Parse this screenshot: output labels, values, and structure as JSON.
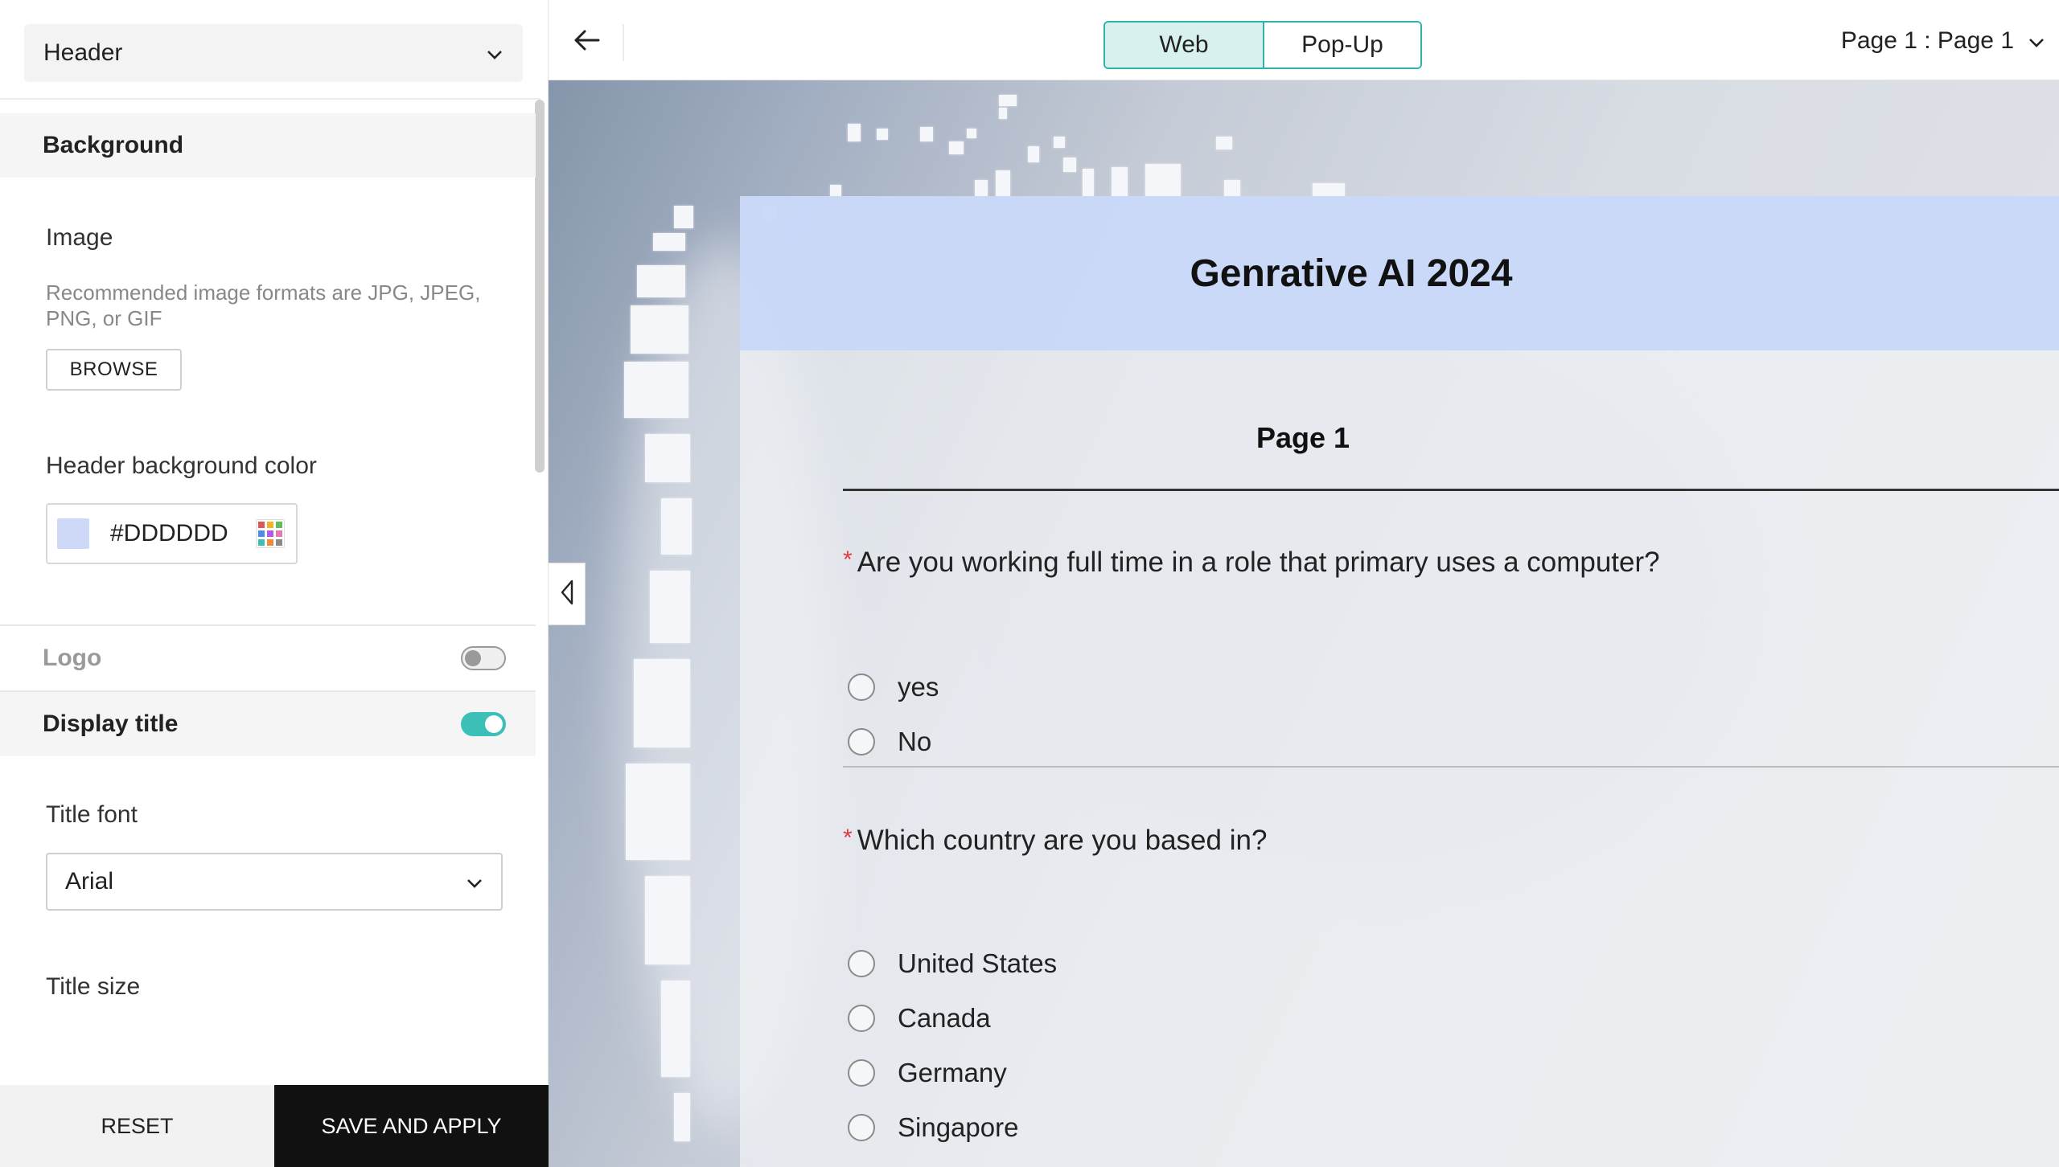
{
  "left_panel": {
    "section_select": "Header",
    "background_group": "Background",
    "image_label": "Image",
    "image_hint": "Recommended image formats are JPG, JPEG, PNG, or GIF",
    "browse_label": "BROWSE",
    "header_bg_color_label": "Header background color",
    "header_bg_color_value": "#DDDDDD",
    "header_bg_swatch_color": "#cdd9f6",
    "logo_label": "Logo",
    "logo_enabled": false,
    "display_title_label": "Display title",
    "display_title_enabled": true,
    "title_font_label": "Title font",
    "title_font_value": "Arial",
    "title_size_label": "Title size",
    "reset_label": "RESET",
    "save_label": "SAVE AND APPLY"
  },
  "topbar": {
    "view_tabs": [
      "Web",
      "Pop-Up"
    ],
    "active_view": "Web",
    "page_selector": "Page 1 : Page 1"
  },
  "form": {
    "title": "Genrative AI 2024",
    "page_name": "Page 1",
    "questions": [
      {
        "text": "Are you working full time in a role that primary  uses a computer?",
        "required": true,
        "options": [
          "yes",
          "No"
        ]
      },
      {
        "text": "Which country are you based in?",
        "required": true,
        "options": [
          "United States",
          "Canada",
          "Germany",
          "Singapore"
        ]
      }
    ]
  },
  "colors": {
    "accent": "#3bbfb7",
    "save_button": "#111111",
    "required_marker": "#e23b3b"
  },
  "icons": [
    "chevron-down-icon",
    "back-arrow-icon",
    "color-palette-icon",
    "collapse-left-icon"
  ]
}
